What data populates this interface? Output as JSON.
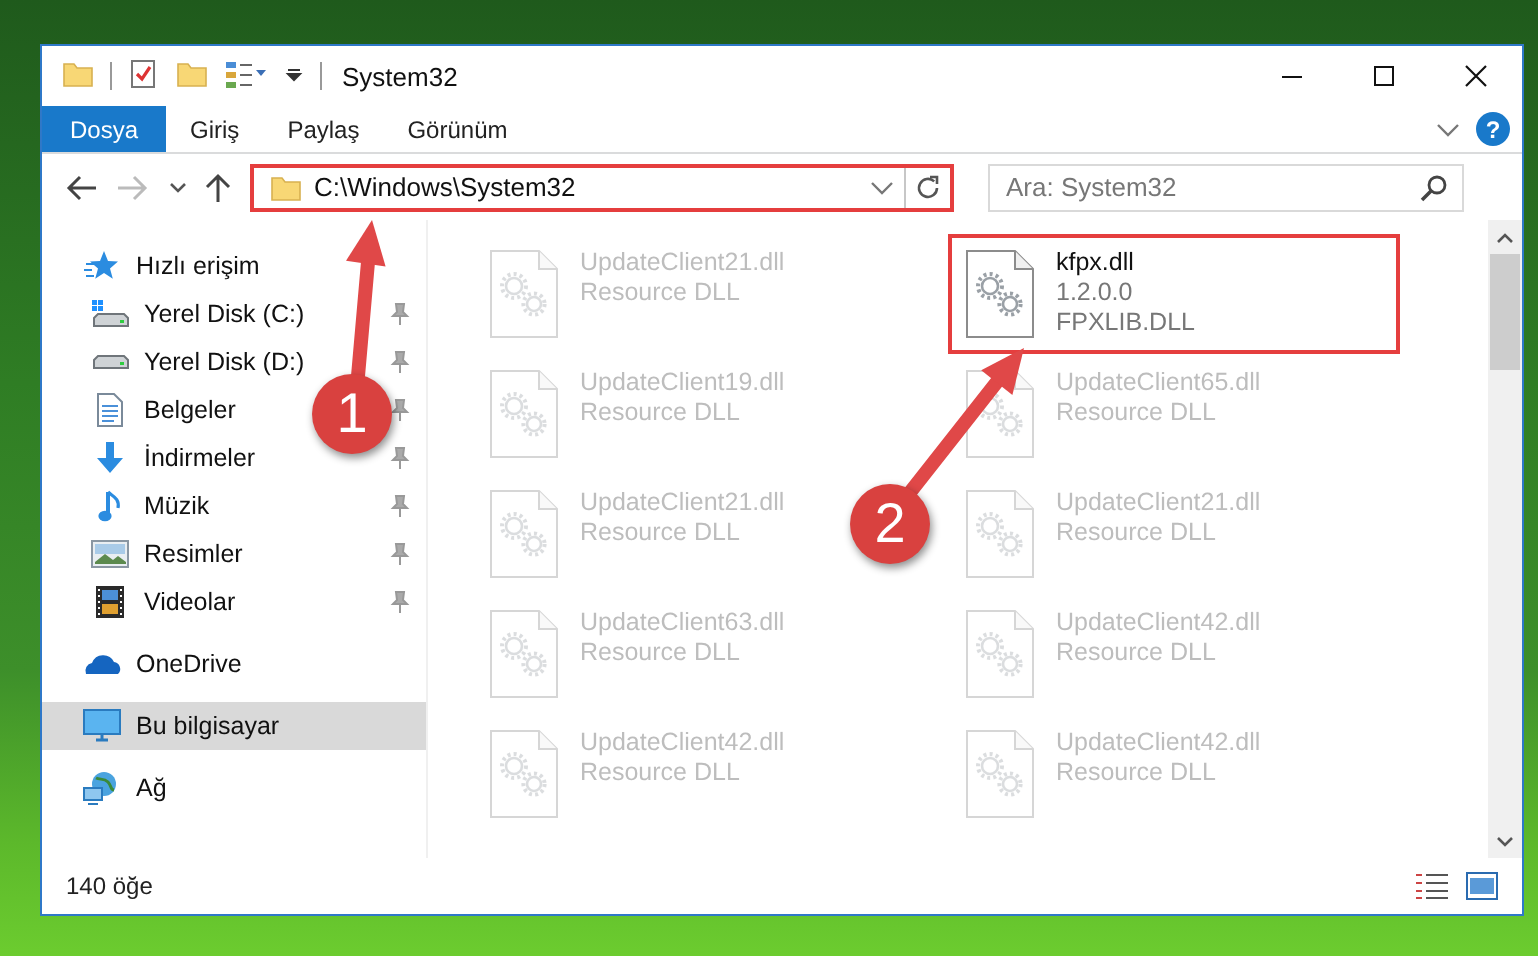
{
  "window": {
    "title": "System32"
  },
  "ribbon": {
    "tabs": [
      {
        "label": "Dosya",
        "kind": "file",
        "selected": false
      },
      {
        "label": "Giriş",
        "kind": "tab",
        "selected": false
      },
      {
        "label": "Paylaş",
        "kind": "tab",
        "selected": false
      },
      {
        "label": "Görünüm",
        "kind": "tab",
        "selected": false
      }
    ],
    "help_label": "?"
  },
  "address_bar": {
    "path": "C:\\Windows\\System32",
    "highlighted": true
  },
  "search": {
    "placeholder": "Ara: System32"
  },
  "sidebar": {
    "items": [
      {
        "label": "Hızlı erişim",
        "kind": "quick-access",
        "selected": false,
        "children": [
          {
            "label": "Yerel Disk (C:)",
            "kind": "system-drive",
            "pinned": true,
            "selected": false
          },
          {
            "label": "Yerel Disk (D:)",
            "kind": "drive",
            "pinned": true,
            "selected": false
          },
          {
            "label": "Belgeler",
            "kind": "documents",
            "pinned": true,
            "selected": false
          },
          {
            "label": "İndirmeler",
            "kind": "downloads",
            "pinned": true,
            "selected": false
          },
          {
            "label": "Müzik",
            "kind": "music",
            "pinned": true,
            "selected": false
          },
          {
            "label": "Resimler",
            "kind": "pictures",
            "pinned": true,
            "selected": false
          },
          {
            "label": "Videolar",
            "kind": "videos",
            "pinned": true,
            "selected": false
          }
        ]
      },
      {
        "label": "OneDrive",
        "kind": "cloud",
        "selected": false
      },
      {
        "label": "Bu bilgisayar",
        "kind": "computer",
        "selected": true
      },
      {
        "label": "Ağ",
        "kind": "network",
        "selected": false
      }
    ]
  },
  "files": [
    {
      "name": "UpdateClient21.dll",
      "details": [
        "Resource DLL"
      ],
      "dimmed": true,
      "highlighted": false
    },
    {
      "name": "kfpx.dll",
      "details": [
        "1.2.0.0",
        "FPXLIB.DLL"
      ],
      "dimmed": false,
      "highlighted": true
    },
    {
      "name": "UpdateClient19.dll",
      "details": [
        "Resource DLL"
      ],
      "dimmed": true,
      "highlighted": false
    },
    {
      "name": "UpdateClient65.dll",
      "details": [
        "Resource DLL"
      ],
      "dimmed": true,
      "highlighted": false
    },
    {
      "name": "UpdateClient21.dll",
      "details": [
        "Resource DLL"
      ],
      "dimmed": true,
      "highlighted": false
    },
    {
      "name": "UpdateClient21.dll",
      "details": [
        "Resource DLL"
      ],
      "dimmed": true,
      "highlighted": false
    },
    {
      "name": "UpdateClient63.dll",
      "details": [
        "Resource DLL"
      ],
      "dimmed": true,
      "highlighted": false
    },
    {
      "name": "UpdateClient42.dll",
      "details": [
        "Resource DLL"
      ],
      "dimmed": true,
      "highlighted": false
    },
    {
      "name": "UpdateClient42.dll",
      "details": [
        "Resource DLL"
      ],
      "dimmed": true,
      "highlighted": false
    },
    {
      "name": "UpdateClient42.dll",
      "details": [
        "Resource DLL"
      ],
      "dimmed": true,
      "highlighted": false
    }
  ],
  "callouts": [
    {
      "label": "1"
    },
    {
      "label": "2"
    }
  ],
  "status_bar": {
    "item_count": "140 öğe"
  }
}
